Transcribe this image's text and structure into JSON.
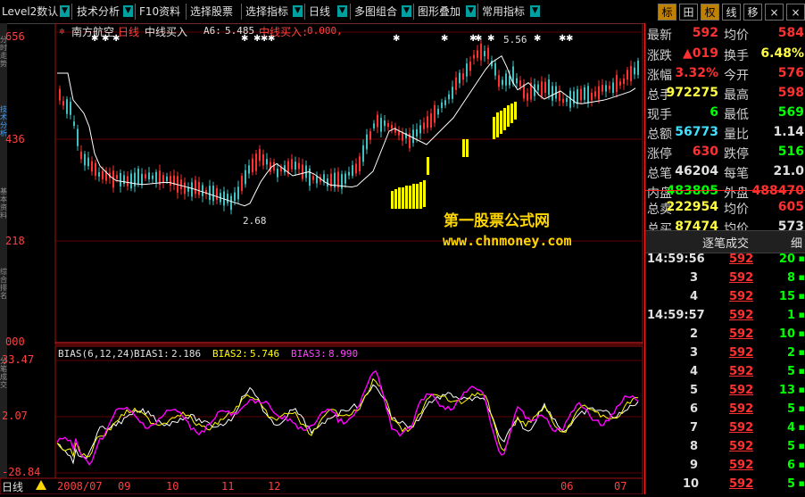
{
  "toolbar": {
    "items": [
      "Level2数认",
      "技术分析",
      "F10资料",
      "选择股票",
      "选择指标",
      "日线",
      "多图组合",
      "图形叠加",
      "常用指标"
    ],
    "right_buttons": [
      "标",
      "田",
      "权",
      "线",
      "移",
      "×",
      "×"
    ]
  },
  "left_tabs": [
    "分时走势",
    "技术分析",
    "基本资料",
    "综合排名",
    "分笔成交"
  ],
  "main_chart": {
    "stock_name": "南方航空",
    "period": "日线",
    "indicator": "中线买入",
    "a6_label": "A6:",
    "a6_value": "5.485",
    "buy_label": "中线买入:",
    "buy_value": "0.000,",
    "y_labels": [
      "656",
      "436",
      "218",
      "000"
    ],
    "price_high_label": "5.56",
    "price_low_label": "2.68"
  },
  "bias_panel": {
    "title": "BIAS(6,12,24)",
    "bias1_label": "BIAS1:",
    "bias1_value": "2.186",
    "bias2_label": "BIAS2:",
    "bias2_value": "5.746",
    "bias3_label": "BIAS3:",
    "bias3_value": "8.990",
    "y_labels": [
      "33.47",
      "2.07",
      "-28.84"
    ]
  },
  "x_axis": {
    "labels": [
      "2008/07",
      "09",
      "10",
      "11",
      "12",
      "06",
      "07"
    ],
    "period_button": "日线"
  },
  "watermark": {
    "title": "第一股票公式网",
    "url": "www.chnmoney.com"
  },
  "quote": {
    "rows": [
      {
        "l1": "最新",
        "v1": "592",
        "c1": "#ff3030",
        "l2": "均价",
        "v2": "584",
        "c2": "#ff3030"
      },
      {
        "l1": "涨跌",
        "v1": "▲019",
        "c1": "#ff3030",
        "l2": "换手",
        "v2": "6.48%",
        "c2": "#ffff40"
      },
      {
        "l1": "涨幅",
        "v1": "3.32%",
        "c1": "#ff3030",
        "l2": "今开",
        "v2": "576",
        "c2": "#ff3030"
      },
      {
        "l1": "总手",
        "v1": "972275",
        "c1": "#ffff40",
        "l2": "最高",
        "v2": "598",
        "c2": "#ff3030"
      },
      {
        "l1": "现手",
        "v1": "6",
        "c1": "#00ff00",
        "l2": "最低",
        "v2": "569",
        "c2": "#00ff00"
      },
      {
        "l1": "总额",
        "v1": "56773",
        "c1": "#40e0ff",
        "l2": "量比",
        "v2": "1.14",
        "c2": "#e0e0e0"
      },
      {
        "l1": "涨停",
        "v1": "630",
        "c1": "#ff3030",
        "l2": "跌停",
        "v2": "516",
        "c2": "#00ff00"
      },
      {
        "l1": "总笔",
        "v1": "46204",
        "c1": "#e0e0e0",
        "l2": "每笔",
        "v2": "21.0",
        "c2": "#e0e0e0"
      },
      {
        "l1": "内盘",
        "v1": "483805",
        "c1": "#00ff00",
        "l2": "外盘",
        "v2": "488470",
        "c2": "#ff3030"
      },
      {
        "l1": "总卖",
        "v1": "222954",
        "c1": "#ffff40",
        "l2": "均价",
        "v2": "605",
        "c2": "#ff3030"
      },
      {
        "l1": "总买",
        "v1": "87474",
        "c1": "#ffff40",
        "l2": "均价",
        "v2": "573",
        "c2": "#e0e0e0"
      }
    ]
  },
  "trades_header": {
    "title": "逐笔成交",
    "detail": "细"
  },
  "trades": [
    {
      "time": "14:59:56",
      "price": "592",
      "vol": "20",
      "vc": "#00ff00"
    },
    {
      "time": "3",
      "price": "592",
      "vol": "8",
      "vc": "#00ff00"
    },
    {
      "time": "4",
      "price": "592",
      "vol": "15",
      "vc": "#00ff00"
    },
    {
      "time": "14:59:57",
      "price": "592",
      "vol": "1",
      "vc": "#00ff00"
    },
    {
      "time": "2",
      "price": "592",
      "vol": "10",
      "vc": "#00ff00"
    },
    {
      "time": "3",
      "price": "592",
      "vol": "2",
      "vc": "#00ff00"
    },
    {
      "time": "4",
      "price": "592",
      "vol": "5",
      "vc": "#00ff00"
    },
    {
      "time": "5",
      "price": "592",
      "vol": "13",
      "vc": "#00ff00"
    },
    {
      "time": "6",
      "price": "592",
      "vol": "5",
      "vc": "#00ff00"
    },
    {
      "time": "7",
      "price": "592",
      "vol": "4",
      "vc": "#00ff00"
    },
    {
      "time": "8",
      "price": "592",
      "vol": "5",
      "vc": "#00ff00"
    },
    {
      "time": "9",
      "price": "592",
      "vol": "6",
      "vc": "#00ff00"
    },
    {
      "time": "10",
      "price": "592",
      "vol": "5",
      "vc": "#00ff00"
    }
  ]
}
